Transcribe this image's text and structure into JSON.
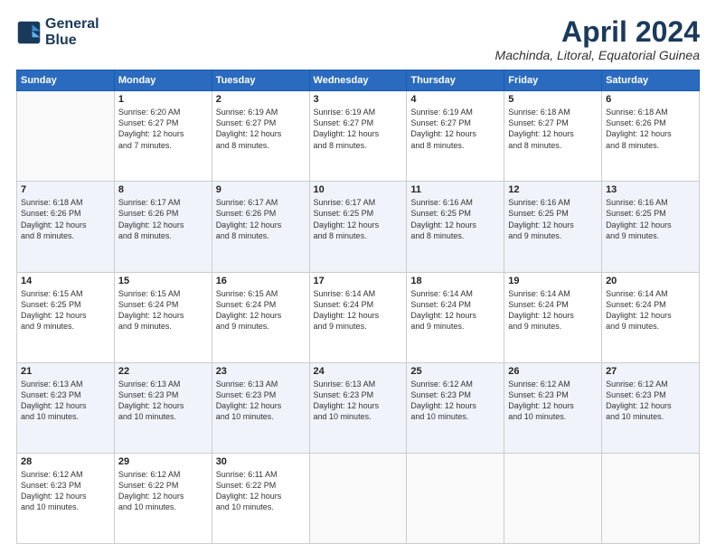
{
  "logo": {
    "line1": "General",
    "line2": "Blue"
  },
  "title": "April 2024",
  "subtitle": "Machinda, Litoral, Equatorial Guinea",
  "days_of_week": [
    "Sunday",
    "Monday",
    "Tuesday",
    "Wednesday",
    "Thursday",
    "Friday",
    "Saturday"
  ],
  "weeks": [
    [
      {
        "day": "",
        "info": ""
      },
      {
        "day": "1",
        "info": "Sunrise: 6:20 AM\nSunset: 6:27 PM\nDaylight: 12 hours\nand 7 minutes."
      },
      {
        "day": "2",
        "info": "Sunrise: 6:19 AM\nSunset: 6:27 PM\nDaylight: 12 hours\nand 8 minutes."
      },
      {
        "day": "3",
        "info": "Sunrise: 6:19 AM\nSunset: 6:27 PM\nDaylight: 12 hours\nand 8 minutes."
      },
      {
        "day": "4",
        "info": "Sunrise: 6:19 AM\nSunset: 6:27 PM\nDaylight: 12 hours\nand 8 minutes."
      },
      {
        "day": "5",
        "info": "Sunrise: 6:18 AM\nSunset: 6:27 PM\nDaylight: 12 hours\nand 8 minutes."
      },
      {
        "day": "6",
        "info": "Sunrise: 6:18 AM\nSunset: 6:26 PM\nDaylight: 12 hours\nand 8 minutes."
      }
    ],
    [
      {
        "day": "7",
        "info": "Sunrise: 6:18 AM\nSunset: 6:26 PM\nDaylight: 12 hours\nand 8 minutes."
      },
      {
        "day": "8",
        "info": "Sunrise: 6:17 AM\nSunset: 6:26 PM\nDaylight: 12 hours\nand 8 minutes."
      },
      {
        "day": "9",
        "info": "Sunrise: 6:17 AM\nSunset: 6:26 PM\nDaylight: 12 hours\nand 8 minutes."
      },
      {
        "day": "10",
        "info": "Sunrise: 6:17 AM\nSunset: 6:25 PM\nDaylight: 12 hours\nand 8 minutes."
      },
      {
        "day": "11",
        "info": "Sunrise: 6:16 AM\nSunset: 6:25 PM\nDaylight: 12 hours\nand 8 minutes."
      },
      {
        "day": "12",
        "info": "Sunrise: 6:16 AM\nSunset: 6:25 PM\nDaylight: 12 hours\nand 9 minutes."
      },
      {
        "day": "13",
        "info": "Sunrise: 6:16 AM\nSunset: 6:25 PM\nDaylight: 12 hours\nand 9 minutes."
      }
    ],
    [
      {
        "day": "14",
        "info": "Sunrise: 6:15 AM\nSunset: 6:25 PM\nDaylight: 12 hours\nand 9 minutes."
      },
      {
        "day": "15",
        "info": "Sunrise: 6:15 AM\nSunset: 6:24 PM\nDaylight: 12 hours\nand 9 minutes."
      },
      {
        "day": "16",
        "info": "Sunrise: 6:15 AM\nSunset: 6:24 PM\nDaylight: 12 hours\nand 9 minutes."
      },
      {
        "day": "17",
        "info": "Sunrise: 6:14 AM\nSunset: 6:24 PM\nDaylight: 12 hours\nand 9 minutes."
      },
      {
        "day": "18",
        "info": "Sunrise: 6:14 AM\nSunset: 6:24 PM\nDaylight: 12 hours\nand 9 minutes."
      },
      {
        "day": "19",
        "info": "Sunrise: 6:14 AM\nSunset: 6:24 PM\nDaylight: 12 hours\nand 9 minutes."
      },
      {
        "day": "20",
        "info": "Sunrise: 6:14 AM\nSunset: 6:24 PM\nDaylight: 12 hours\nand 9 minutes."
      }
    ],
    [
      {
        "day": "21",
        "info": "Sunrise: 6:13 AM\nSunset: 6:23 PM\nDaylight: 12 hours\nand 10 minutes."
      },
      {
        "day": "22",
        "info": "Sunrise: 6:13 AM\nSunset: 6:23 PM\nDaylight: 12 hours\nand 10 minutes."
      },
      {
        "day": "23",
        "info": "Sunrise: 6:13 AM\nSunset: 6:23 PM\nDaylight: 12 hours\nand 10 minutes."
      },
      {
        "day": "24",
        "info": "Sunrise: 6:13 AM\nSunset: 6:23 PM\nDaylight: 12 hours\nand 10 minutes."
      },
      {
        "day": "25",
        "info": "Sunrise: 6:12 AM\nSunset: 6:23 PM\nDaylight: 12 hours\nand 10 minutes."
      },
      {
        "day": "26",
        "info": "Sunrise: 6:12 AM\nSunset: 6:23 PM\nDaylight: 12 hours\nand 10 minutes."
      },
      {
        "day": "27",
        "info": "Sunrise: 6:12 AM\nSunset: 6:23 PM\nDaylight: 12 hours\nand 10 minutes."
      }
    ],
    [
      {
        "day": "28",
        "info": "Sunrise: 6:12 AM\nSunset: 6:23 PM\nDaylight: 12 hours\nand 10 minutes."
      },
      {
        "day": "29",
        "info": "Sunrise: 6:12 AM\nSunset: 6:22 PM\nDaylight: 12 hours\nand 10 minutes."
      },
      {
        "day": "30",
        "info": "Sunrise: 6:11 AM\nSunset: 6:22 PM\nDaylight: 12 hours\nand 10 minutes."
      },
      {
        "day": "",
        "info": ""
      },
      {
        "day": "",
        "info": ""
      },
      {
        "day": "",
        "info": ""
      },
      {
        "day": "",
        "info": ""
      }
    ]
  ],
  "colors": {
    "header_bg": "#2a6bbf",
    "title_color": "#1a3a5c"
  }
}
